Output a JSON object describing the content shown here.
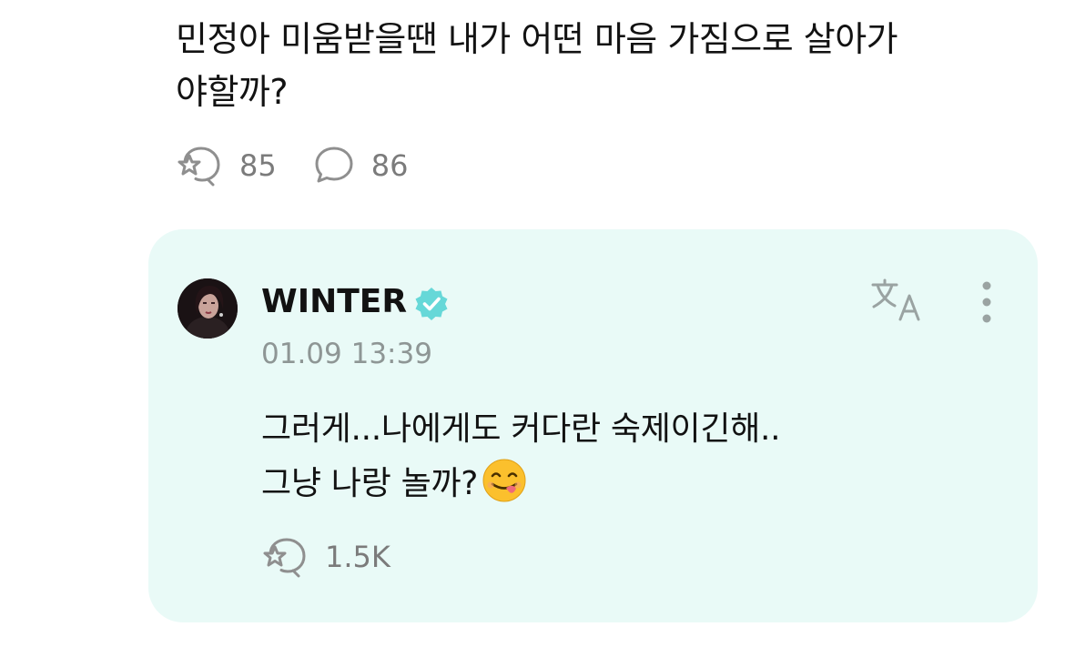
{
  "post": {
    "text_line1": "민정아 미움받을땐 내가 어떤 마음 가짐으로 살아가",
    "text_line2": "야할까?",
    "like_icon": "star-heart-bubble-icon",
    "like_count": "85",
    "comment_icon": "chat-bubble-icon",
    "comment_count": "86"
  },
  "reply": {
    "author": "WINTER",
    "verified_icon": "verified-badge-icon",
    "timestamp": "01.09 13:39",
    "text_line1": "그러게...나에게도 커다란 숙제이긴해..",
    "text_line2": "그냥 나랑 놀까?",
    "emoji": "savoring-food-emoji",
    "like_icon": "star-heart-bubble-icon",
    "like_count": "1.5K",
    "translate_icon": "translate-icon",
    "more_icon": "more-vertical-icon"
  },
  "colors": {
    "card_background": "#e9faf7",
    "verified_badge": "#66d8d8",
    "icon_gray": "#8f8f8f",
    "meta_gray": "#8e9695",
    "text": "#121212"
  }
}
